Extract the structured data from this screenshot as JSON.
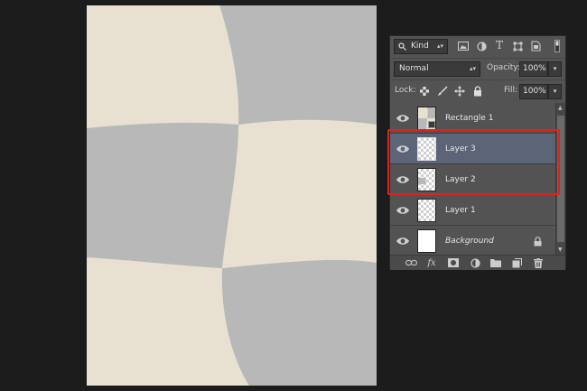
{
  "panel": {
    "filter": {
      "label": "Kind",
      "icons": [
        "image-filter-icon",
        "adjustment-filter-icon",
        "type-filter-icon",
        "shape-filter-icon",
        "smart-object-filter-icon",
        "filter-toggle-icon"
      ]
    },
    "blend_mode": "Normal",
    "opacity": {
      "label": "Opacity:",
      "value": "100%"
    },
    "lock": {
      "label": "Lock:",
      "icons": [
        "lock-transparent-pixels-icon",
        "lock-image-pixels-icon",
        "lock-position-icon",
        "lock-all-icon"
      ]
    },
    "fill": {
      "label": "Fill:",
      "value": "100%"
    },
    "layers": [
      {
        "name": "Rectangle 1",
        "thumb": "smart-shape",
        "selected": false
      },
      {
        "name": "Layer 3",
        "thumb": "transparent",
        "selected": true
      },
      {
        "name": "Layer 2",
        "thumb": "transparent-shape",
        "selected": true
      },
      {
        "name": "Layer 1",
        "thumb": "transparent",
        "selected": false
      },
      {
        "name": "Background",
        "thumb": "white",
        "selected": false,
        "locked": true
      }
    ],
    "footer_icons": [
      "link-layers-icon",
      "fx-icon",
      "add-mask-icon",
      "adjustment-layer-icon",
      "new-group-icon",
      "new-layer-icon",
      "trash-icon"
    ],
    "footer_fx": "fx"
  },
  "colors": {
    "cream": "#e8e1d1",
    "gray": "#b8b8b8",
    "selection": "#5c6478",
    "highlight": "#e0211d"
  }
}
